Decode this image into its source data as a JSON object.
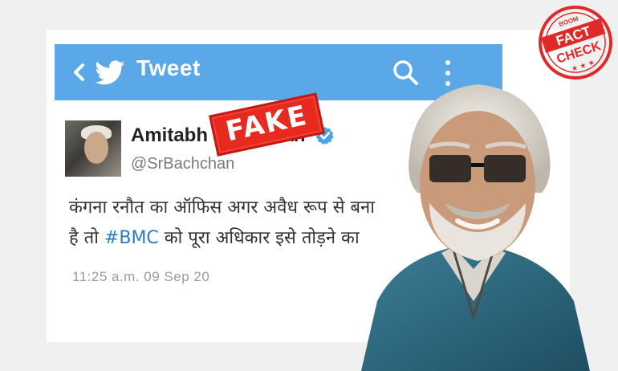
{
  "twitter_bar": {
    "title": "Tweet",
    "icons": [
      "back-arrow-icon",
      "twitter-bird-icon",
      "search-icon",
      "more-vertical-icon"
    ]
  },
  "tweet": {
    "display_name": "Amitabh Bachchan",
    "handle": "@SrBachchan",
    "text_line1": "कंगना रनौत का ऑफिस अगर अवैध रूप से बना",
    "text_line2_pre": "है तो ",
    "hashtag": "#BMC",
    "text_line2_post": " को पूरा अधिकार इसे तोड़ने का",
    "timestamp": "11:25 a.m.  09 Sep 20"
  },
  "overlay": {
    "fake_label": "FAKE"
  },
  "badge": {
    "top_text": "BOOM",
    "line1": "FACT",
    "line2": "CHECK"
  },
  "colors": {
    "twitter_blue": "#5ba8e8",
    "fake_red": "#e8291f",
    "badge_red": "#e02a2a",
    "hashtag_blue": "#2b7bbf"
  }
}
